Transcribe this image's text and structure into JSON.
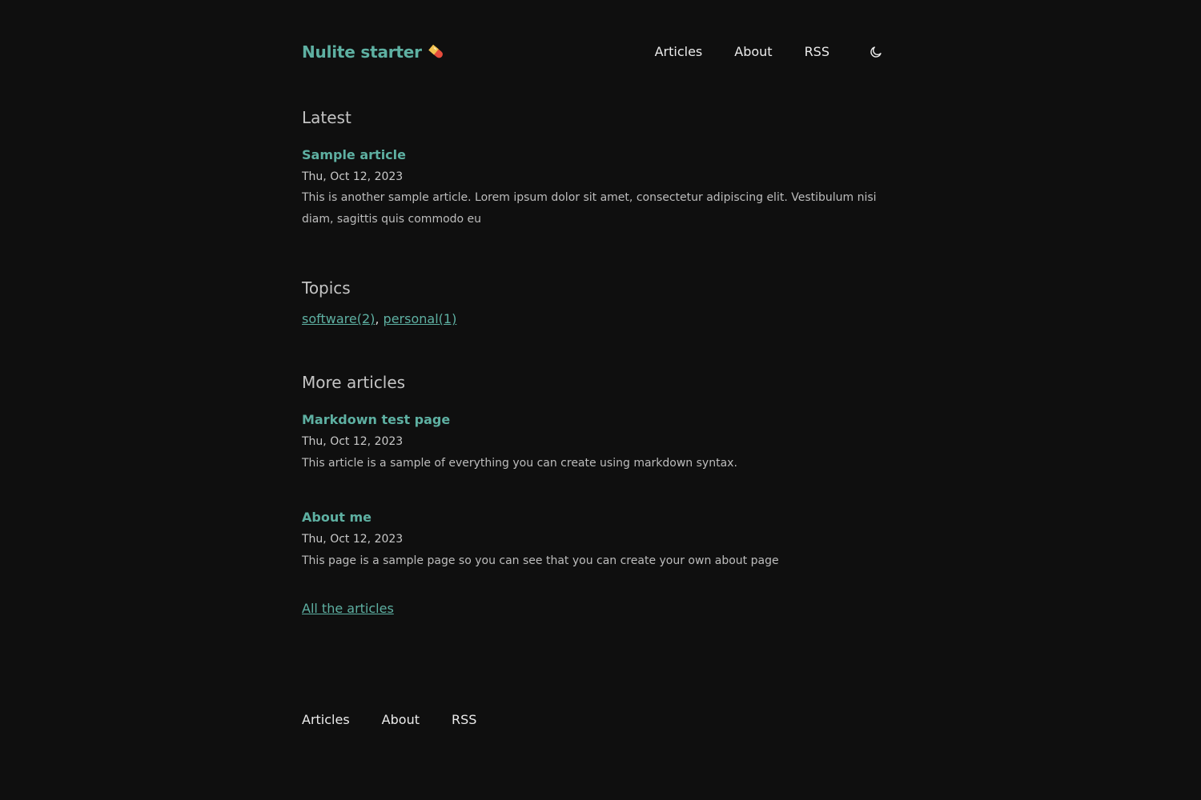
{
  "site": {
    "brand": "Nulite starter",
    "brand_icon": "pill-icon"
  },
  "nav": {
    "items": [
      {
        "label": "Articles"
      },
      {
        "label": "About"
      },
      {
        "label": "RSS"
      }
    ],
    "theme_icon": "moon-icon"
  },
  "latest": {
    "heading": "Latest",
    "article": {
      "title": "Sample article",
      "date": "Thu, Oct 12, 2023",
      "description": "This is another sample article. Lorem ipsum dolor sit amet, consectetur adipiscing elit. Vestibulum nisi diam, sagittis quis commodo eu"
    }
  },
  "topics": {
    "heading": "Topics",
    "items": [
      {
        "label": "software(2)"
      },
      {
        "label": "personal(1)"
      }
    ],
    "separator": ", "
  },
  "more": {
    "heading": "More articles",
    "articles": [
      {
        "title": "Markdown test page",
        "date": "Thu, Oct 12, 2023",
        "description": "This article is a sample of everything you can create using markdown syntax."
      },
      {
        "title": "About me",
        "date": "Thu, Oct 12, 2023",
        "description": "This page is a sample page so you can see that you can create your own about page"
      }
    ],
    "all_link": "All the articles"
  },
  "footer": {
    "items": [
      {
        "label": "Articles"
      },
      {
        "label": "About"
      },
      {
        "label": "RSS"
      }
    ]
  },
  "colors": {
    "background": "#0f0f0f",
    "accent": "#5eb0a2",
    "text": "#ececec",
    "muted": "#bdbdbd"
  }
}
